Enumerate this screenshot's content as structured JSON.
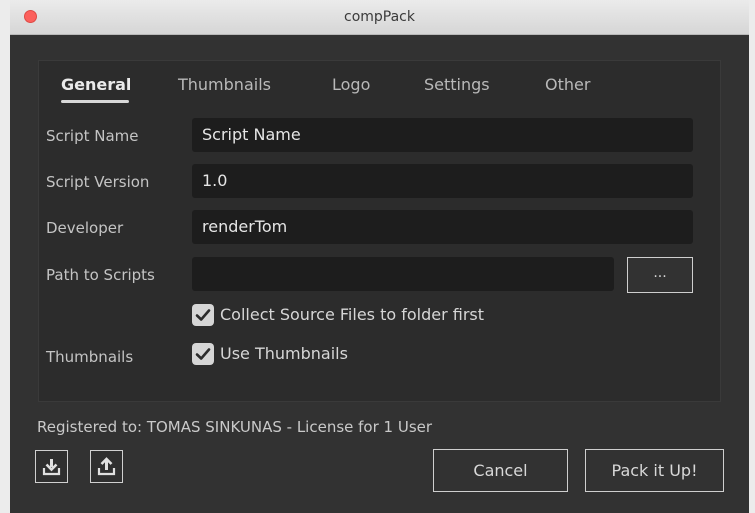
{
  "window": {
    "title": "compPack"
  },
  "tabs": [
    {
      "label": "General",
      "active": true
    },
    {
      "label": "Thumbnails",
      "active": false
    },
    {
      "label": "Logo",
      "active": false
    },
    {
      "label": "Settings",
      "active": false
    },
    {
      "label": "Other",
      "active": false
    }
  ],
  "form": {
    "script_name": {
      "label": "Script Name",
      "value": "Script Name"
    },
    "script_version": {
      "label": "Script Version",
      "value": "1.0"
    },
    "developer": {
      "label": "Developer",
      "value": "renderTom"
    },
    "path_to_scripts": {
      "label": "Path to Scripts",
      "value": "",
      "browse_label": "..."
    },
    "collect_source": {
      "label": "Collect Source Files to folder first",
      "checked": true
    },
    "thumbnails": {
      "label": "Thumbnails",
      "checkbox_label": "Use Thumbnails",
      "checked": true
    }
  },
  "footer": {
    "registered_text": "Registered to: TOMAS SINKUNAS  - License for 1 User",
    "import_icon": "download-icon",
    "export_icon": "upload-icon",
    "cancel_label": "Cancel",
    "pack_label": "Pack it Up!"
  },
  "colors": {
    "window_bg": "#323232",
    "panel_bg": "#2c2c2c",
    "field_bg": "#1d1d1d",
    "close_button": "#fc605c",
    "checkbox": "#d6d6d6"
  }
}
